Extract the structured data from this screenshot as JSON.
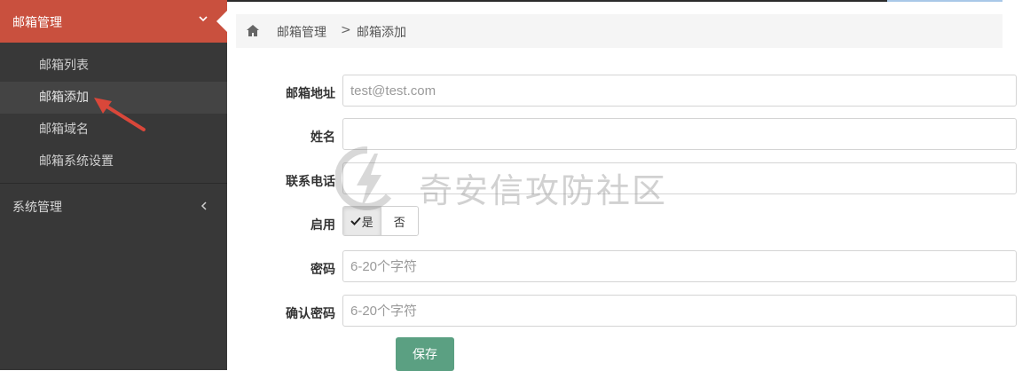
{
  "sidebar": {
    "mail_menu": {
      "label": "邮箱管理",
      "icon": "chevron-down-icon"
    },
    "items": [
      {
        "label": "邮箱列表"
      },
      {
        "label": "邮箱添加",
        "active": true
      },
      {
        "label": "邮箱域名"
      },
      {
        "label": "邮箱系统设置"
      }
    ],
    "system_menu": {
      "label": "系统管理",
      "icon": "chevron-left-icon"
    }
  },
  "breadcrumb": {
    "icon": "home-icon",
    "items": [
      "邮箱管理",
      "邮箱添加"
    ],
    "separator": ">"
  },
  "form": {
    "email": {
      "label": "邮箱地址",
      "value": "",
      "placeholder": "test@test.com"
    },
    "name": {
      "label": "姓名",
      "value": "",
      "placeholder": ""
    },
    "phone": {
      "label": "联系电话",
      "value": "",
      "placeholder": ""
    },
    "enabled": {
      "label": "启用",
      "options": [
        "是",
        "否"
      ],
      "selected": "是"
    },
    "password": {
      "label": "密码",
      "value": "",
      "placeholder": "6-20个字符"
    },
    "confirm": {
      "label": "确认密码",
      "value": "",
      "placeholder": "6-20个字符"
    },
    "save_label": "保存"
  },
  "watermark": {
    "text": "奇安信攻防社区"
  },
  "colors": {
    "sidebar_bg": "#383838",
    "menu_active_bg": "#c9503e",
    "save_button": "#5ba082",
    "annotation_arrow": "#d9473a"
  }
}
